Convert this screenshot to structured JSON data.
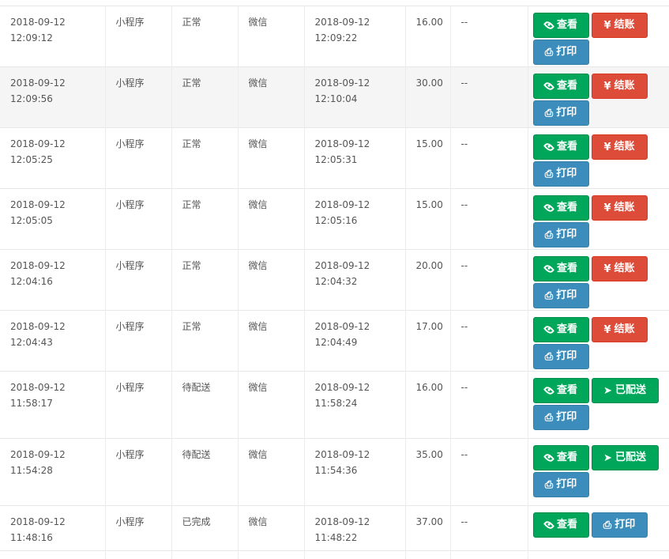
{
  "labels": {
    "view": "查看",
    "settle": "结账",
    "shipped": "已配送",
    "print": "打印"
  },
  "icons": {
    "view": "eye-icon",
    "settle": "yen-icon",
    "shipped": "paper-plane-icon",
    "print": "printer-icon"
  },
  "colors": {
    "green": "#00a65a",
    "red": "#dd4b39",
    "blue": "#3c8dbc"
  },
  "rows": [
    {
      "order_date": "2018-09-12",
      "order_time": "12:09:12",
      "source": "小程序",
      "status": "正常",
      "payment": "微信",
      "pay_date": "2018-09-12",
      "pay_time": "12:09:22",
      "amount": "16.00",
      "remark": "--"
    },
    {
      "order_date": "2018-09-12",
      "order_time": "12:09:56",
      "source": "小程序",
      "status": "正常",
      "payment": "微信",
      "pay_date": "2018-09-12",
      "pay_time": "12:10:04",
      "amount": "30.00",
      "remark": "--"
    },
    {
      "order_date": "2018-09-12",
      "order_time": "12:05:25",
      "source": "小程序",
      "status": "正常",
      "payment": "微信",
      "pay_date": "2018-09-12",
      "pay_time": "12:05:31",
      "amount": "15.00",
      "remark": "--"
    },
    {
      "order_date": "2018-09-12",
      "order_time": "12:05:05",
      "source": "小程序",
      "status": "正常",
      "payment": "微信",
      "pay_date": "2018-09-12",
      "pay_time": "12:05:16",
      "amount": "15.00",
      "remark": "--"
    },
    {
      "order_date": "2018-09-12",
      "order_time": "12:04:16",
      "source": "小程序",
      "status": "正常",
      "payment": "微信",
      "pay_date": "2018-09-12",
      "pay_time": "12:04:32",
      "amount": "20.00",
      "remark": "--"
    },
    {
      "order_date": "2018-09-12",
      "order_time": "12:04:43",
      "source": "小程序",
      "status": "正常",
      "payment": "微信",
      "pay_date": "2018-09-12",
      "pay_time": "12:04:49",
      "amount": "17.00",
      "remark": "--"
    },
    {
      "order_date": "2018-09-12",
      "order_time": "11:58:17",
      "source": "小程序",
      "status": "待配送",
      "payment": "微信",
      "pay_date": "2018-09-12",
      "pay_time": "11:58:24",
      "amount": "16.00",
      "remark": "--"
    },
    {
      "order_date": "2018-09-12",
      "order_time": "11:54:28",
      "source": "小程序",
      "status": "待配送",
      "payment": "微信",
      "pay_date": "2018-09-12",
      "pay_time": "11:54:36",
      "amount": "35.00",
      "remark": "--"
    },
    {
      "order_date": "2018-09-12",
      "order_time": "11:48:16",
      "source": "小程序",
      "status": "已完成",
      "payment": "微信",
      "pay_date": "2018-09-12",
      "pay_time": "11:48:22",
      "amount": "37.00",
      "remark": "--"
    }
  ]
}
